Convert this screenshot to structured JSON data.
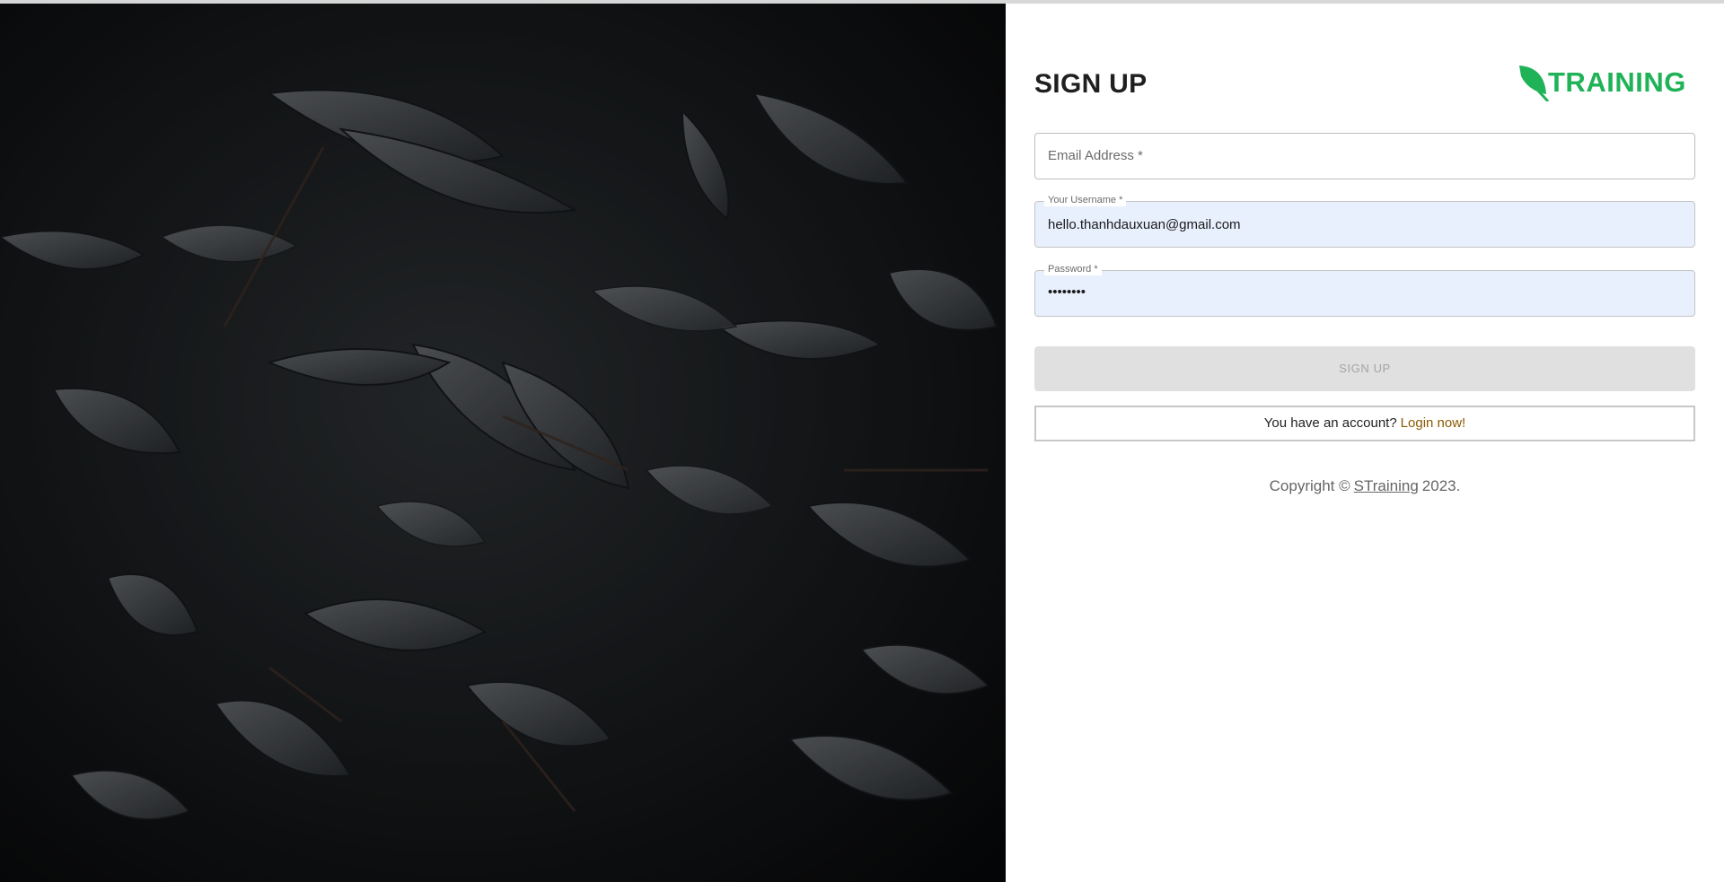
{
  "page": {
    "title": "SIGN UP"
  },
  "logo": {
    "text": "TRAINING",
    "icon": "leaf-icon",
    "color": "#1fb257"
  },
  "form": {
    "email": {
      "placeholder": "Email Address *",
      "value": ""
    },
    "username": {
      "label": "Your Username *",
      "value": "hello.thanhdauxuan@gmail.com"
    },
    "password": {
      "label": "Password *",
      "value": "••••••••"
    },
    "submit_label": "SIGN UP"
  },
  "login_prompt": {
    "text": "You have an account?",
    "link": "Login now!"
  },
  "footer": {
    "prefix": "Copyright ©",
    "brand": "STraining",
    "year": "2023."
  },
  "colors": {
    "accent": "#1fb257",
    "autofill": "#e8f0fe",
    "link": "#8a5a00"
  }
}
